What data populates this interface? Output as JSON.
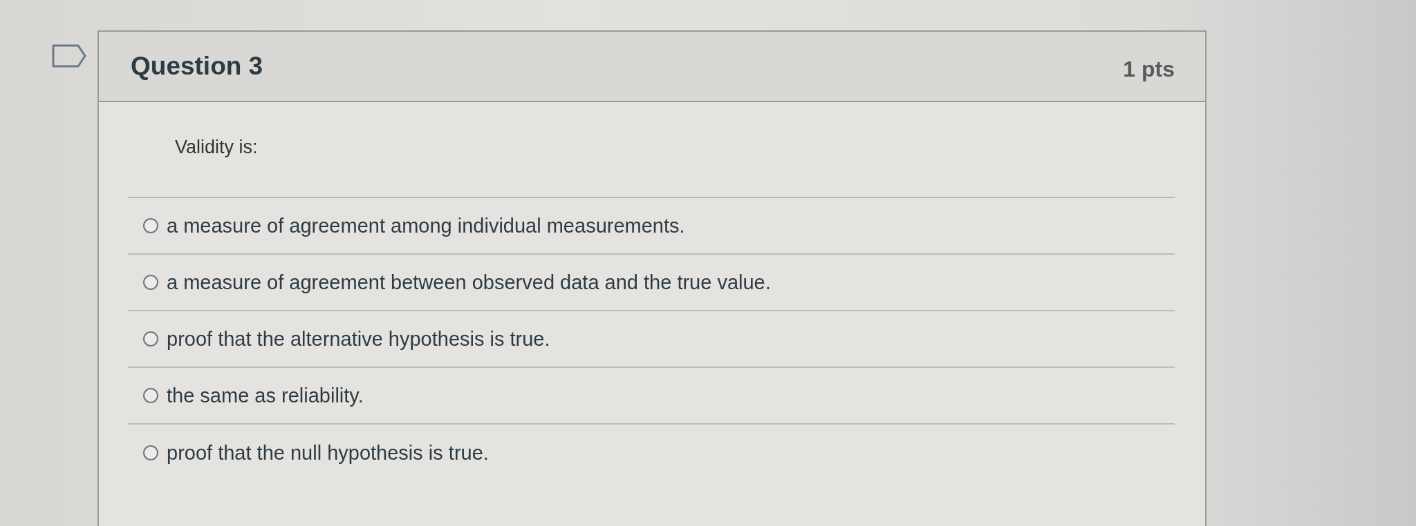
{
  "question": {
    "title": "Question 3",
    "points": "1 pts",
    "prompt": "Validity is:"
  },
  "answers": [
    {
      "label": "a measure of agreement among individual measurements.",
      "selected": false
    },
    {
      "label": "a measure of agreement between observed data and the true value.",
      "selected": false
    },
    {
      "label": "proof that the alternative hypothesis is true.",
      "selected": false
    },
    {
      "label": "the same as reliability.",
      "selected": false
    },
    {
      "label": "proof that the null hypothesis is true.",
      "selected": false
    }
  ]
}
